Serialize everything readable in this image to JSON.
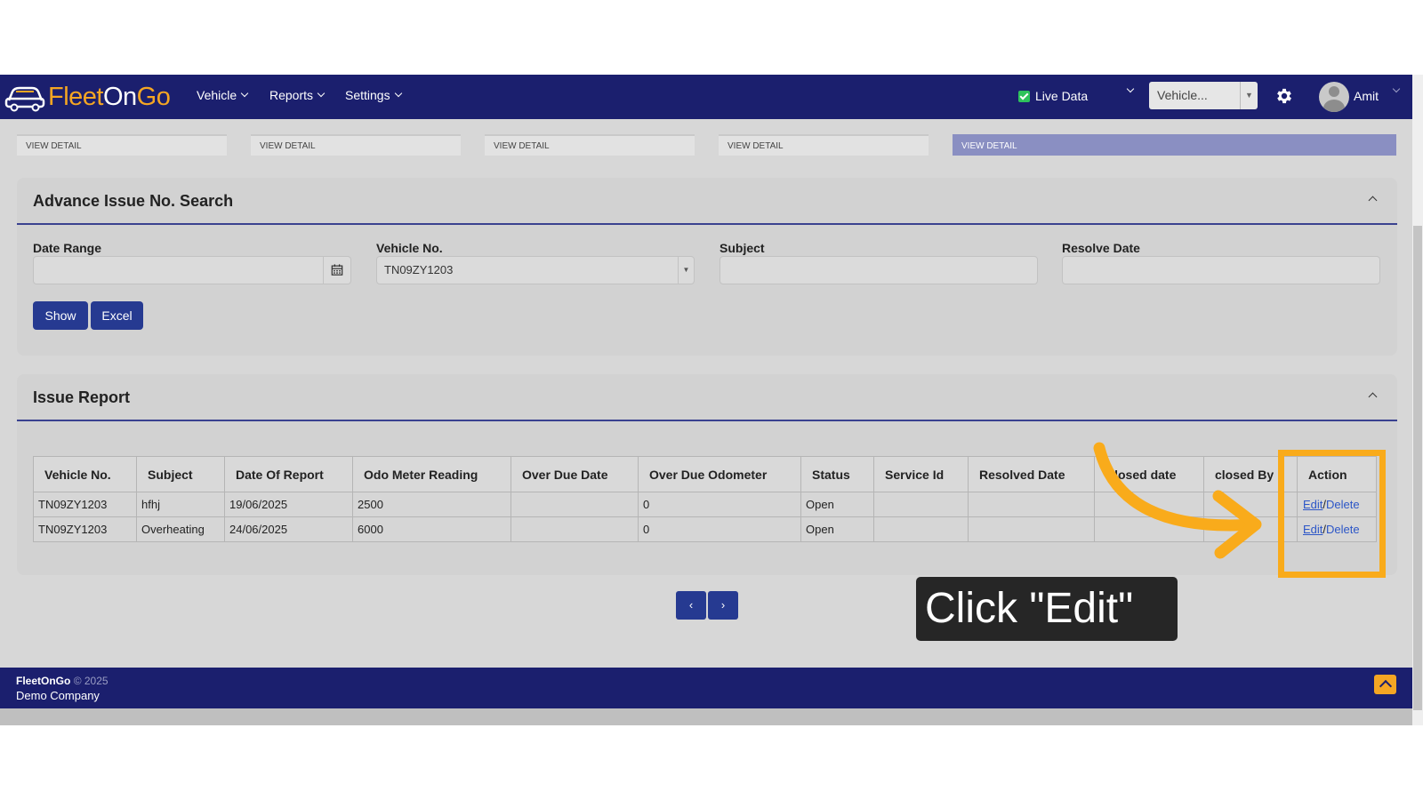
{
  "brand": {
    "part1": "Fleet",
    "part2": "On",
    "part3": "Go"
  },
  "nav": {
    "menus": [
      {
        "label": "Vehicle"
      },
      {
        "label": "Reports"
      },
      {
        "label": "Settings"
      }
    ],
    "live_data_label": "Live Data",
    "vehicle_select_value": "Vehicle...",
    "user_name": "Amit"
  },
  "view_details": [
    {
      "label": "VIEW DETAIL"
    },
    {
      "label": "VIEW DETAIL"
    },
    {
      "label": "VIEW DETAIL"
    },
    {
      "label": "VIEW DETAIL"
    },
    {
      "label": "VIEW DETAIL",
      "active": true
    }
  ],
  "search": {
    "title": "Advance Issue No. Search",
    "fields": {
      "date_range": {
        "label": "Date Range",
        "value": ""
      },
      "vehicle_no": {
        "label": "Vehicle No.",
        "value": "TN09ZY1203"
      },
      "subject": {
        "label": "Subject",
        "value": ""
      },
      "resolve_date": {
        "label": "Resolve Date",
        "value": ""
      }
    },
    "show_label": "Show",
    "excel_label": "Excel"
  },
  "report": {
    "title": "Issue Report",
    "columns": [
      "Vehicle No.",
      "Subject",
      "Date Of Report",
      "Odo Meter Reading",
      "Over Due Date",
      "Over Due Odometer",
      "Status",
      "Service Id",
      "Resolved Date",
      "Closed date",
      "closed By",
      "Action"
    ],
    "rows": [
      {
        "vehicle_no": "TN09ZY1203",
        "subject": "hfhj",
        "date_of_report": "19/06/2025",
        "odo": "2500",
        "over_due_date": "",
        "over_due_odo": "0",
        "status": "Open",
        "service_id": "",
        "resolved_date": "",
        "closed_date": "",
        "closed_by": "",
        "edit": "Edit",
        "sep": "/",
        "delete": "Delete"
      },
      {
        "vehicle_no": "TN09ZY1203",
        "subject": "Overheating",
        "date_of_report": "24/06/2025",
        "odo": "6000",
        "over_due_date": "",
        "over_due_odo": "0",
        "status": "Open",
        "service_id": "",
        "resolved_date": "",
        "closed_date": "",
        "closed_by": "",
        "edit": "Edit",
        "sep": "/",
        "delete": "Delete"
      }
    ]
  },
  "pagination": {
    "prev": "‹",
    "next": "›"
  },
  "footer": {
    "brand": "FleetOnGo",
    "copyright": "© 2025",
    "company": "Demo Company"
  },
  "annotation": {
    "text": "Click \"Edit\"",
    "color": "#f9ab1b"
  },
  "colors": {
    "navbar": "#1b1f6e",
    "accent": "#f5a623",
    "button": "#263a91"
  }
}
